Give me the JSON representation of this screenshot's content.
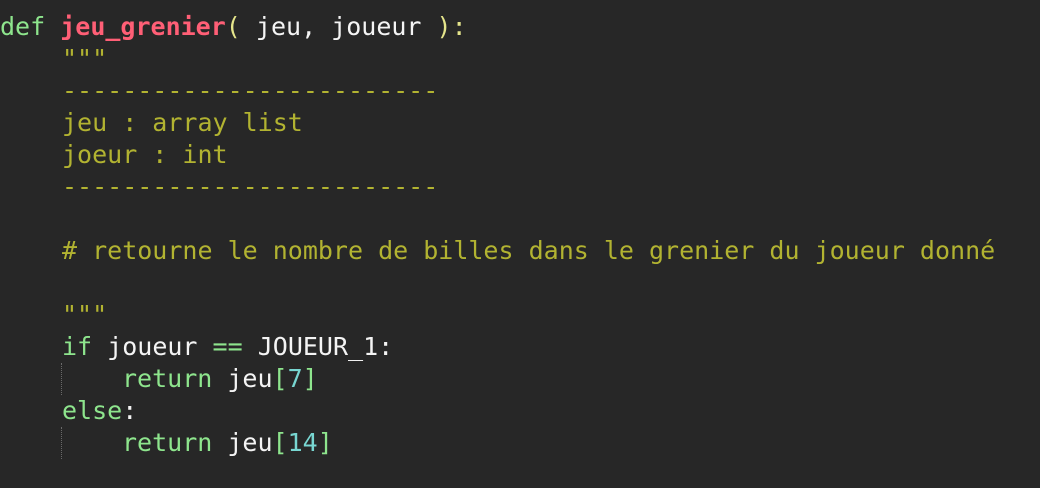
{
  "code": {
    "line1": {
      "keyword": "def",
      "function": "jeu_grenier",
      "open_paren": "(",
      "params": " jeu, joueur ",
      "close_paren": ")",
      "colon": ":"
    },
    "docstring_open": "\"\"\"",
    "separator_1": "-------------------------",
    "param_jeu": "jeu : array list",
    "param_joueur": "joeur : int",
    "separator_2": "-------------------------",
    "comment": "# retourne le nombre de billes dans le grenier du joueur donné",
    "docstring_close": "\"\"\"",
    "if_line": {
      "keyword": "if",
      "left": "joueur",
      "operator": "==",
      "right": "JOUEUR_1",
      "colon": ":"
    },
    "return_1": {
      "keyword": "return",
      "target": "jeu",
      "open_bracket": "[",
      "index": "7",
      "close_bracket": "]"
    },
    "else_line": {
      "keyword": "else",
      "colon": ":"
    },
    "return_2": {
      "keyword": "return",
      "target": "jeu",
      "open_bracket": "[",
      "index": "14",
      "close_bracket": "]"
    }
  },
  "colors": {
    "background": "#272727",
    "keyword": "#8ee58d",
    "function": "#ff5f76",
    "docstring": "#b2b331",
    "number": "#78d6d1",
    "text": "#f4f4f4"
  }
}
